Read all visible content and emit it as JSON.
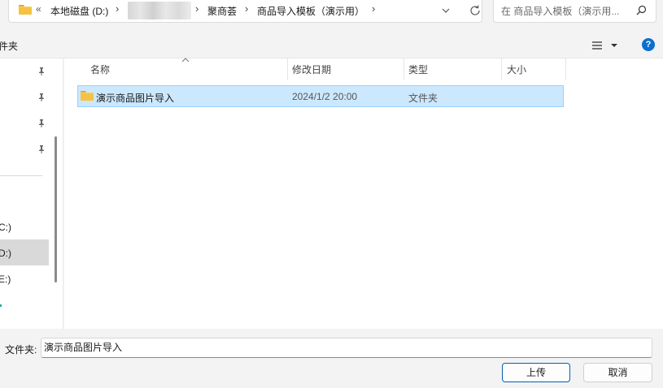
{
  "address": {
    "back_glyph": "«",
    "crumbs": [
      "本地磁盘 (D:)",
      "聚商荟",
      "商品导入模板（演示用）"
    ]
  },
  "search": {
    "placeholder": "在 商品导入模板（演示用..."
  },
  "toolbar": {
    "new_folder_label": "件夹",
    "help_label": "?"
  },
  "nav": {
    "drives": [
      "C:)",
      "D:)",
      "E:)"
    ]
  },
  "columns": {
    "name": "名称",
    "date": "修改日期",
    "type": "类型",
    "size": "大小"
  },
  "files": [
    {
      "name": "演示商品图片导入",
      "date": "2024/1/2 20:00",
      "type": "文件夹",
      "size": ""
    }
  ],
  "bottom": {
    "filename_label": "文件夹:",
    "filename_value": "演示商品图片导入",
    "upload_label": "上传",
    "cancel_label": "取消"
  },
  "colors": {
    "accent": "#0a6fd1",
    "selection": "#cce8ff",
    "folder": "#f5c242"
  }
}
